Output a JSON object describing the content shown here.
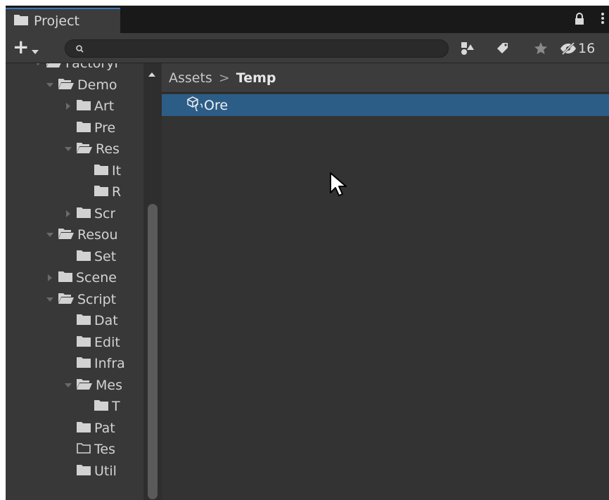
{
  "tab": {
    "label": "Project",
    "icon": "folder-icon"
  },
  "toolbar": {
    "create_label": "+",
    "search": {
      "value": "",
      "placeholder": ""
    },
    "hidden_count": "16"
  },
  "tree": {
    "items": [
      {
        "label": "FactoryF",
        "expanded": true,
        "depth": 0
      },
      {
        "label": "Demo",
        "expanded": true,
        "depth": 1
      },
      {
        "label": "Art",
        "expanded": false,
        "depth": 2
      },
      {
        "label": "Pre",
        "depth": 2
      },
      {
        "label": "Res",
        "expanded": true,
        "depth": 2
      },
      {
        "label": "It",
        "depth": 3
      },
      {
        "label": "R",
        "depth": 3
      },
      {
        "label": "Scr",
        "expanded": false,
        "depth": 2
      },
      {
        "label": "Resou",
        "expanded": true,
        "depth": 1
      },
      {
        "label": "Set",
        "depth": 2
      },
      {
        "label": "Scene",
        "expanded": false,
        "depth": 1
      },
      {
        "label": "Script",
        "expanded": true,
        "depth": 1
      },
      {
        "label": "Dat",
        "depth": 2
      },
      {
        "label": "Edit",
        "depth": 2
      },
      {
        "label": "Infra",
        "depth": 2
      },
      {
        "label": "Mes",
        "expanded": true,
        "depth": 2
      },
      {
        "label": "T",
        "depth": 3
      },
      {
        "label": "Pat",
        "depth": 2
      },
      {
        "label": "Tes",
        "depth": 2,
        "empty": true
      },
      {
        "label": "Util",
        "depth": 2
      }
    ]
  },
  "breadcrumb": {
    "root": "Assets",
    "separator": ">",
    "current": "Temp"
  },
  "assets": [
    {
      "name": "Ore",
      "icon": "scriptable-object-icon",
      "selected": true
    }
  ],
  "colors": {
    "selection": "#2c5d87",
    "tab_accent": "#3a79bb",
    "panel": "#333333",
    "tree": "#383838"
  }
}
